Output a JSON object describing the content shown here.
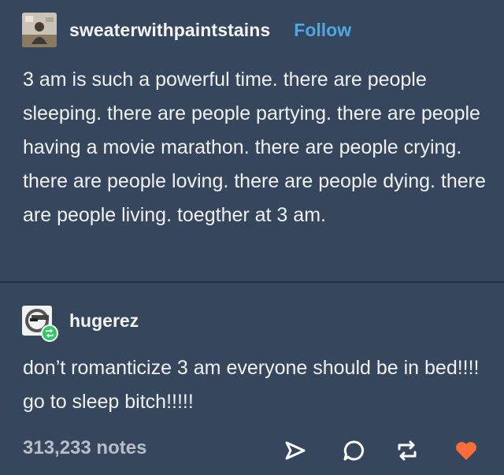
{
  "post": {
    "username": "sweaterwithpaintstains",
    "follow_label": "Follow",
    "text": "3 am is such a powerful time. there are people sleeping. there are people partying. there are people having a movie marathon. there are people crying. there are people loving. there are people dying. there are people living. toegther at 3 am."
  },
  "reblog": {
    "username": "hugerez",
    "text": "don’t romanticize 3 am everyone should be in bed!!!! go to sleep bitch!!!!!"
  },
  "footer": {
    "notes": "313,233 notes",
    "icons": [
      "share-icon",
      "reply-icon",
      "reblog-icon",
      "like-icon"
    ]
  },
  "colors": {
    "background": "#36465d",
    "follow": "#4ba8e3",
    "reblog_badge": "#2fc864",
    "like": "#ff6d3b"
  }
}
